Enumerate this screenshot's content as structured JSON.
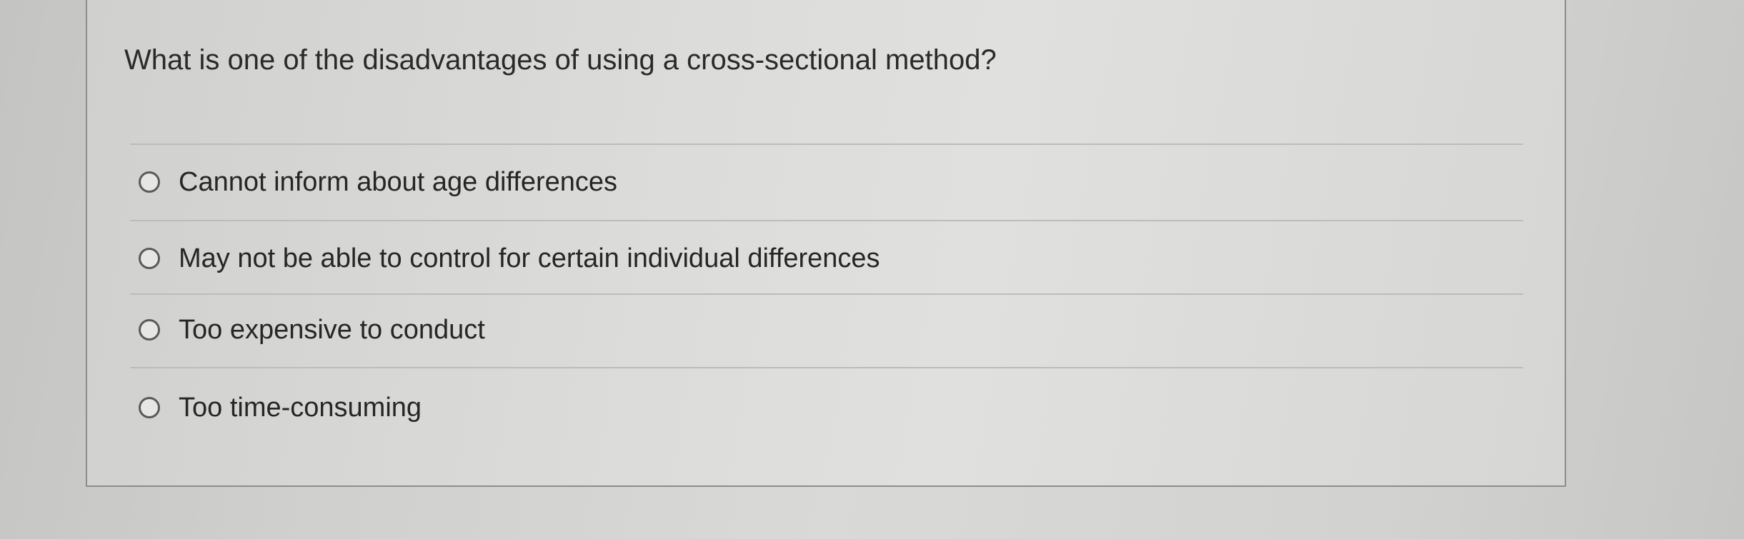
{
  "quiz": {
    "question": "What is one of the disadvantages of using a cross-sectional method?",
    "options": [
      {
        "label": "Cannot inform about age differences",
        "selected": false
      },
      {
        "label": "May not be able to control for certain individual differences",
        "selected": false
      },
      {
        "label": "Too expensive to conduct",
        "selected": false
      },
      {
        "label": "Too time-consuming",
        "selected": false
      }
    ]
  },
  "colors": {
    "card_border": "#8d8d8b",
    "divider": "#bcbcba",
    "text": "#2a2a2a"
  }
}
